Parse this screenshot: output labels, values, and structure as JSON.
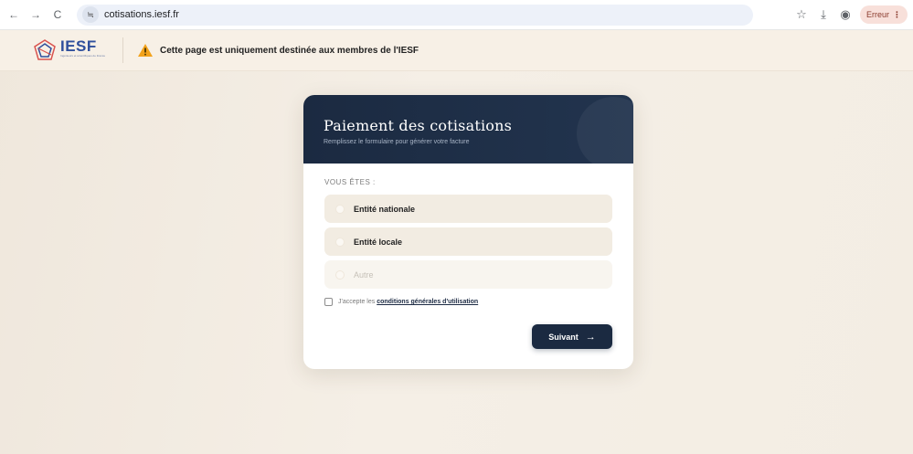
{
  "browser": {
    "back": "←",
    "forward": "→",
    "reload": "C",
    "site_info": "≒",
    "url": "cotisations.iesf.fr",
    "bookmark": "☆",
    "download": "⤓",
    "profile": "◉",
    "error_label": "Erreur",
    "menu": "⋮"
  },
  "header": {
    "logo_word": "IESF",
    "logo_sub": "Ingénieurs et scientifiques de France",
    "warning": "Cette page est uniquement destinée aux membres de l'IESF"
  },
  "form": {
    "title": "Paiement des cotisations",
    "subtitle": "Remplissez le formulaire pour générer votre facture",
    "question": "VOUS ÊTES :",
    "options": [
      {
        "label": "Entité nationale"
      },
      {
        "label": "Entité locale"
      },
      {
        "label": "Autre"
      }
    ],
    "terms_prefix": "J'accepte les ",
    "terms_link": "conditions générales d'utilisation",
    "next_label": "Suivant",
    "next_arrow": "→"
  },
  "colors": {
    "primary": "#1b2a41",
    "background": "#f3ece2",
    "warning": "#f2a21b"
  }
}
